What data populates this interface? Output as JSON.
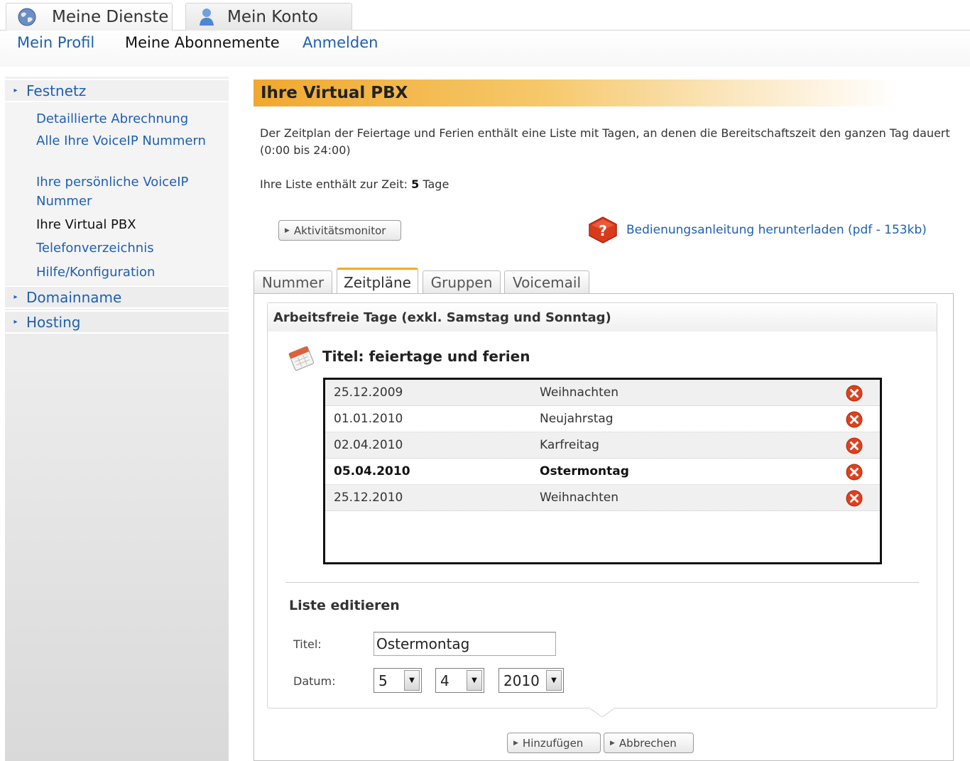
{
  "top_tabs": [
    {
      "label": "Meine Dienste",
      "icon": "globe-icon"
    },
    {
      "label": "Mein Konto",
      "icon": "user-icon"
    }
  ],
  "subnav": {
    "profile": "Mein Profil",
    "subscriptions": "Meine Abonnemente",
    "login": "Anmelden"
  },
  "sidebar": {
    "festnetz": "Festnetz",
    "items": [
      {
        "label": "Detaillierte Abrechnung"
      },
      {
        "label": "Alle Ihre VoiceIP Nummern"
      },
      {
        "label": "Ihre persönliche VoiceIP Nummer"
      },
      {
        "label": "Ihre Virtual PBX",
        "active": true
      },
      {
        "label": "Telefonverzeichnis"
      },
      {
        "label": "Hilfe/Konfiguration"
      }
    ],
    "domain": "Domainname",
    "hosting": "Hosting"
  },
  "content": {
    "title": "Ihre Virtual PBX",
    "intro": "Der Zeitplan der Feiertage und Ferien enthält eine Liste mit Tagen, an denen die Bereitschaftszeit den ganzen Tag dauert (0:00 bis 24:00)",
    "count_prefix": "Ihre Liste enthält zur Zeit:",
    "count_value": "5",
    "count_suffix": "Tage",
    "monitor_button": "Aktivitätsmonitor",
    "help_link": "Bedienungsanleitung herunterladen (pdf - 153kb)"
  },
  "tabs": [
    "Nummer",
    "Zeitpläne",
    "Gruppen",
    "Voicemail"
  ],
  "schedule": {
    "heading": "Arbeitsfreie Tage (exkl. Samstag und Sonntag)",
    "title": "Titel: feiertage und ferien",
    "rows": [
      {
        "date": "25.12.2009",
        "name": "Weihnachten"
      },
      {
        "date": "01.01.2010",
        "name": "Neujahrstag"
      },
      {
        "date": "02.04.2010",
        "name": "Karfreitag"
      },
      {
        "date": "05.04.2010",
        "name": "Ostermontag"
      },
      {
        "date": "25.12.2010",
        "name": "Weihnachten"
      }
    ]
  },
  "edit": {
    "heading": "Liste editieren",
    "title_label": "Titel:",
    "title_value": "Ostermontag",
    "date_label": "Datum:",
    "day": "5",
    "month": "4",
    "year": "2010",
    "add_button": "Hinzufügen",
    "cancel_button": "Abbrechen"
  },
  "colors": {
    "accent": "#f0a830",
    "link": "#1f5fb0",
    "delete": "#e0401c"
  }
}
